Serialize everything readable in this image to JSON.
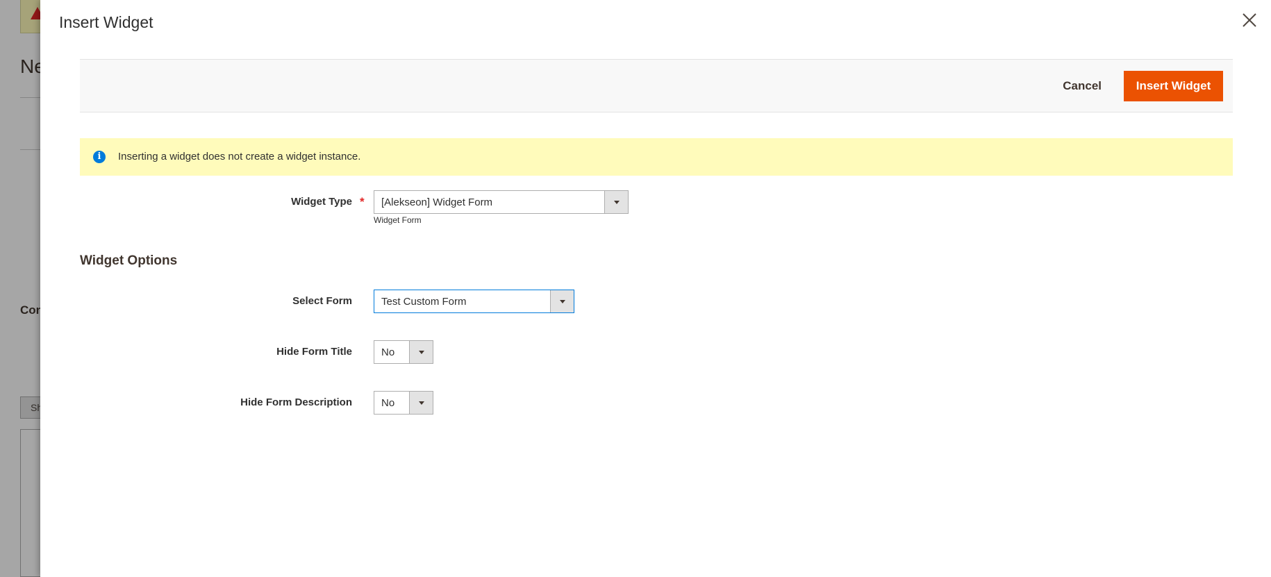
{
  "background": {
    "title_fragment": "Ne",
    "section_fragment": "Con",
    "button_fragment": "Sh"
  },
  "modal": {
    "title": "Insert Widget",
    "close_icon": "close-icon"
  },
  "actions": {
    "cancel_label": "Cancel",
    "insert_label": "Insert Widget"
  },
  "message": {
    "icon": "info-icon",
    "text": "Inserting a widget does not create a widget instance."
  },
  "widget_type": {
    "label": "Widget Type",
    "required": "*",
    "value": "[Alekseon] Widget Form",
    "note": "Widget Form"
  },
  "widget_options": {
    "heading": "Widget Options",
    "select_form": {
      "label": "Select Form",
      "value": "Test Custom Form"
    },
    "hide_form_title": {
      "label": "Hide Form Title",
      "value": "No"
    },
    "hide_form_description": {
      "label": "Hide Form Description",
      "value": "No"
    }
  },
  "colors": {
    "primary_button": "#eb5202",
    "message_bg": "#fffbbb",
    "info_icon": "#007bdb",
    "required": "#e22626",
    "focus_border": "#007bdb"
  }
}
